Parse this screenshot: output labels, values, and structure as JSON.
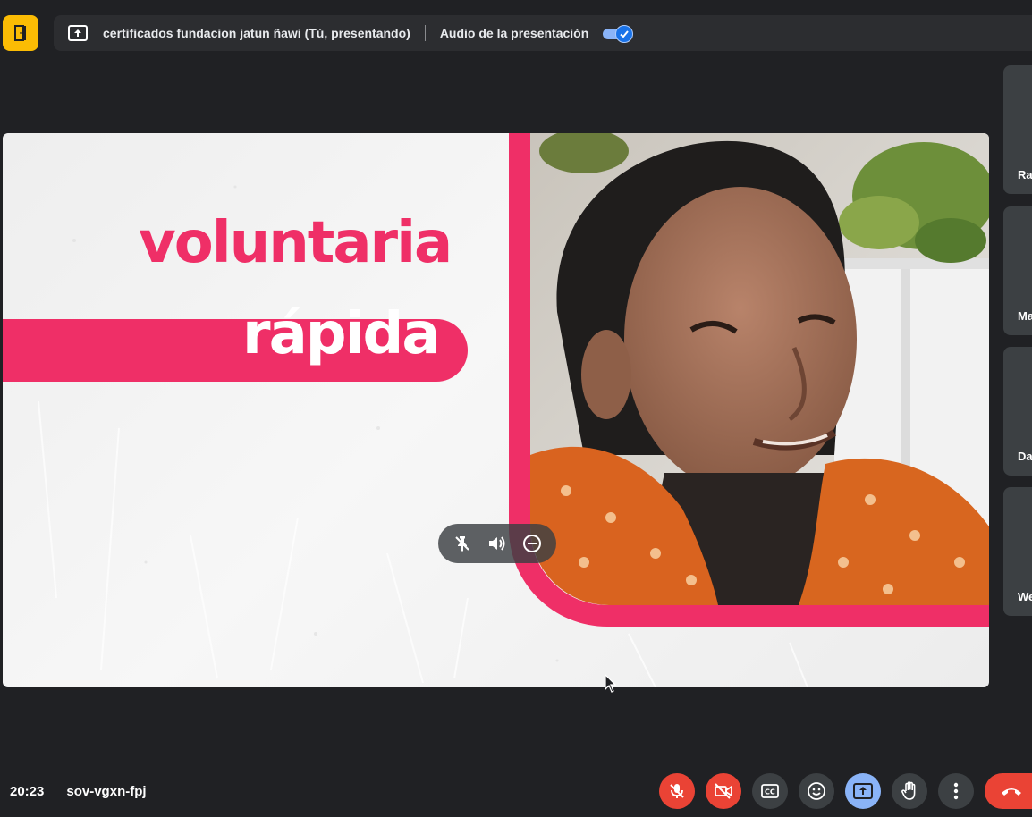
{
  "top_bar": {
    "presentation_title": "certificados fundacion jatun ñawi (Tú, presentando)",
    "audio_label": "Audio de la presentación",
    "audio_enabled": true
  },
  "slide": {
    "line_1": "voluntaria",
    "line_2": "rápida"
  },
  "participants": [
    {
      "name": "Ra"
    },
    {
      "name": "Ma"
    },
    {
      "name": "Da"
    },
    {
      "name": "We"
    }
  ],
  "meeting": {
    "time": "20:23",
    "code": "sov-vgxn-fpj"
  },
  "icons": {
    "top_left": "exit-door-icon",
    "present": "present-to-all-icon",
    "controls": [
      "mic-off-icon",
      "camera-off-icon",
      "captions-icon",
      "emoji-icon",
      "present-icon",
      "raise-hand-icon",
      "more-options-icon",
      "end-call-icon"
    ]
  },
  "colors": {
    "accent_pink": "#ef2f67",
    "activity_yellow": "#fbbc04",
    "danger_red": "#ea4335",
    "active_blue": "#8ab4f8"
  }
}
